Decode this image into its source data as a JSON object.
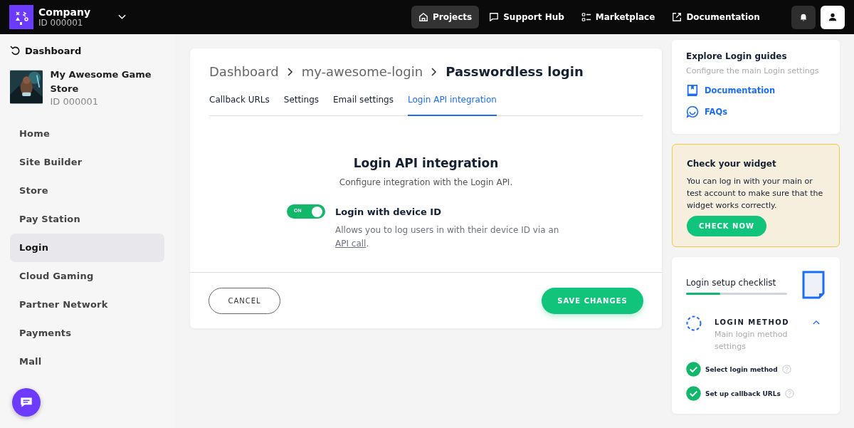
{
  "topbar": {
    "company": {
      "name": "Company",
      "id": "ID 000001"
    },
    "nav": [
      {
        "label": "Projects",
        "selected": true
      },
      {
        "label": "Support Hub",
        "selected": false
      },
      {
        "label": "Marketplace",
        "selected": false
      },
      {
        "label": "Documentation",
        "selected": false
      }
    ]
  },
  "sidebar": {
    "back": "Dashboard",
    "project": {
      "name": "My Awesome Game Store",
      "id": "ID 000001"
    },
    "items": [
      {
        "label": "Home",
        "selected": false
      },
      {
        "label": "Site Builder",
        "selected": false
      },
      {
        "label": "Store",
        "selected": false
      },
      {
        "label": "Pay Station",
        "selected": false
      },
      {
        "label": "Login",
        "selected": true
      },
      {
        "label": "Cloud Gaming",
        "selected": false
      },
      {
        "label": "Partner Network",
        "selected": false
      },
      {
        "label": "Payments",
        "selected": false
      },
      {
        "label": "Mall",
        "selected": false
      }
    ]
  },
  "main": {
    "breadcrumb": [
      "Dashboard",
      "my-awesome-login",
      "Passwordless login"
    ],
    "tabs": [
      {
        "label": "Callback URLs",
        "selected": false
      },
      {
        "label": "Settings",
        "selected": false
      },
      {
        "label": "Email settings",
        "selected": false
      },
      {
        "label": "Login API integration",
        "selected": true
      }
    ],
    "section": {
      "title": "Login API integration",
      "subtitle": "Configure integration with the Login API.",
      "toggle": {
        "on": true,
        "text": "ON",
        "label": "Login with device ID",
        "description": "Allows you to log users in with their device ID via an",
        "link": "API call",
        "after": "."
      }
    },
    "buttons": {
      "cancel": "CANCEL",
      "save": "SAVE CHANGES"
    }
  },
  "guides": {
    "title": "Explore Login guides",
    "subtitle": "Configure the main Login settings",
    "links": [
      {
        "label": "Documentation"
      },
      {
        "label": "FAQs"
      }
    ]
  },
  "widget": {
    "title": "Check your widget",
    "text": "You can log in with your main or test account to make sure that the widget works correctly.",
    "button": "CHECK NOW"
  },
  "checklist": {
    "title": "Login setup checklist",
    "level": 0.34,
    "section": {
      "title": "LOGIN METHOD",
      "subtitle": "Main login method settings",
      "expanded": true
    },
    "items": [
      {
        "label": "Select login method",
        "checked": true
      },
      {
        "label": "Set up callback URLs",
        "checked": true
      }
    ]
  }
}
